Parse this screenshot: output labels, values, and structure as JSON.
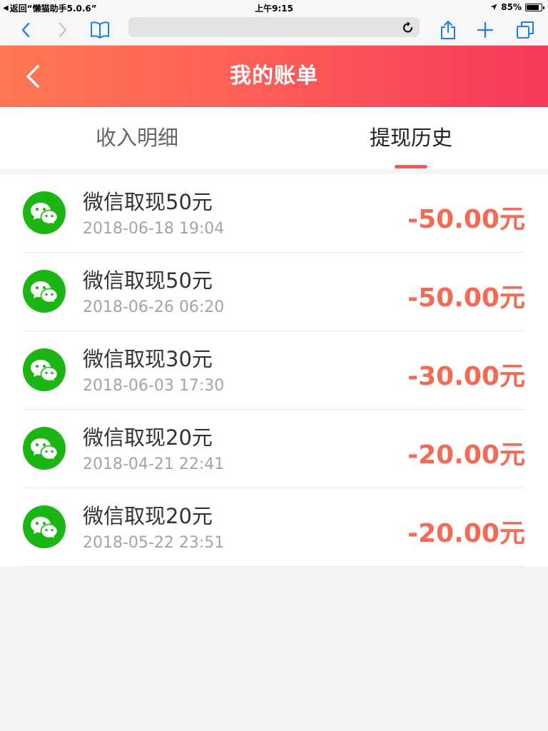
{
  "statusbar": {
    "back_app": "返回“懒猫助手5.0.6”",
    "time": "上午9:15",
    "battery": "85%",
    "battery_level": 0.85
  },
  "browser": {
    "url": ""
  },
  "header": {
    "title": "我的账单"
  },
  "tabs": [
    {
      "label": "收入明细",
      "active": false
    },
    {
      "label": "提现历史",
      "active": true
    }
  ],
  "records": [
    {
      "title": "微信取现50元",
      "time": "2018-06-18 19:04",
      "amount": "-50.00元",
      "icon": "wechat-icon"
    },
    {
      "title": "微信取现50元",
      "time": "2018-06-26 06:20",
      "amount": "-50.00元",
      "icon": "wechat-icon"
    },
    {
      "title": "微信取现30元",
      "time": "2018-06-03 17:30",
      "amount": "-30.00元",
      "icon": "wechat-icon"
    },
    {
      "title": "微信取现20元",
      "time": "2018-04-21 22:41",
      "amount": "-20.00元",
      "icon": "wechat-icon"
    },
    {
      "title": "微信取现20元",
      "time": "2018-05-22 23:51",
      "amount": "-20.00元",
      "icon": "wechat-icon"
    }
  ],
  "colors": {
    "header_gradient_start": "#ff7752",
    "header_gradient_end": "#f7385a",
    "amount": "#f56a55",
    "wechat_green": "#1bb614",
    "tab_indicator": "#f05a5a"
  }
}
